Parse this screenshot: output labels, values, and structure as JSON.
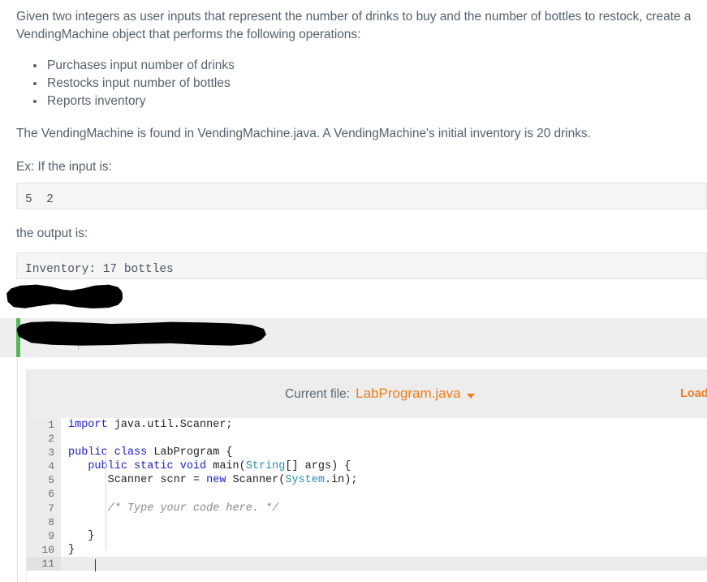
{
  "description": {
    "intro": "Given two integers as user inputs that represent the number of drinks to buy and the number of bottles to restock, create a VendingMachine object that performs the following operations:",
    "bullets": [
      "Purchases input number of drinks",
      "Restocks input number of bottles",
      "Reports inventory"
    ],
    "found_note": "The VendingMachine is found in VendingMachine.java. A VendingMachine's initial inventory is 20 drinks.",
    "example_intro": "Ex: If the input is:",
    "output_intro": "the output is:"
  },
  "samples": {
    "input": "5  2",
    "output": "Inventory: 17 bottles"
  },
  "editor": {
    "current_file_label": "Current file:",
    "current_file_name": "LabProgram.java",
    "dropdown_icon": "chevron-down-icon",
    "load_default_label": "Load defa",
    "lines": [
      {
        "num": "1",
        "active": false
      },
      {
        "num": "2",
        "active": false
      },
      {
        "num": "3",
        "active": false
      },
      {
        "num": "4",
        "active": false
      },
      {
        "num": "5",
        "active": false
      },
      {
        "num": "6",
        "active": false
      },
      {
        "num": "7",
        "active": false
      },
      {
        "num": "8",
        "active": false
      },
      {
        "num": "9",
        "active": false
      },
      {
        "num": "10",
        "active": false
      },
      {
        "num": "11",
        "active": true
      }
    ],
    "code_lines": [
      "import java.util.Scanner;",
      "",
      "public class LabProgram {",
      "   public static void main(String[] args) {",
      "      Scanner scnr = new Scanner(System.in);",
      "",
      "      /* Type your code here. */",
      "",
      "   }",
      "}",
      ""
    ]
  },
  "colors": {
    "accent_orange": "#f07d1b",
    "accent_green": "#57b65a",
    "body_text": "#56606b",
    "keyword_blue": "#2020c0",
    "type_teal": "#2a8fa8",
    "comment_gray": "#8a8a8a",
    "banner_gray": "#eeeeee",
    "toolbar_gray": "#ededed",
    "gutter_gray": "#ececec",
    "sample_bg": "#f5f5f5",
    "redaction": "#000000"
  }
}
